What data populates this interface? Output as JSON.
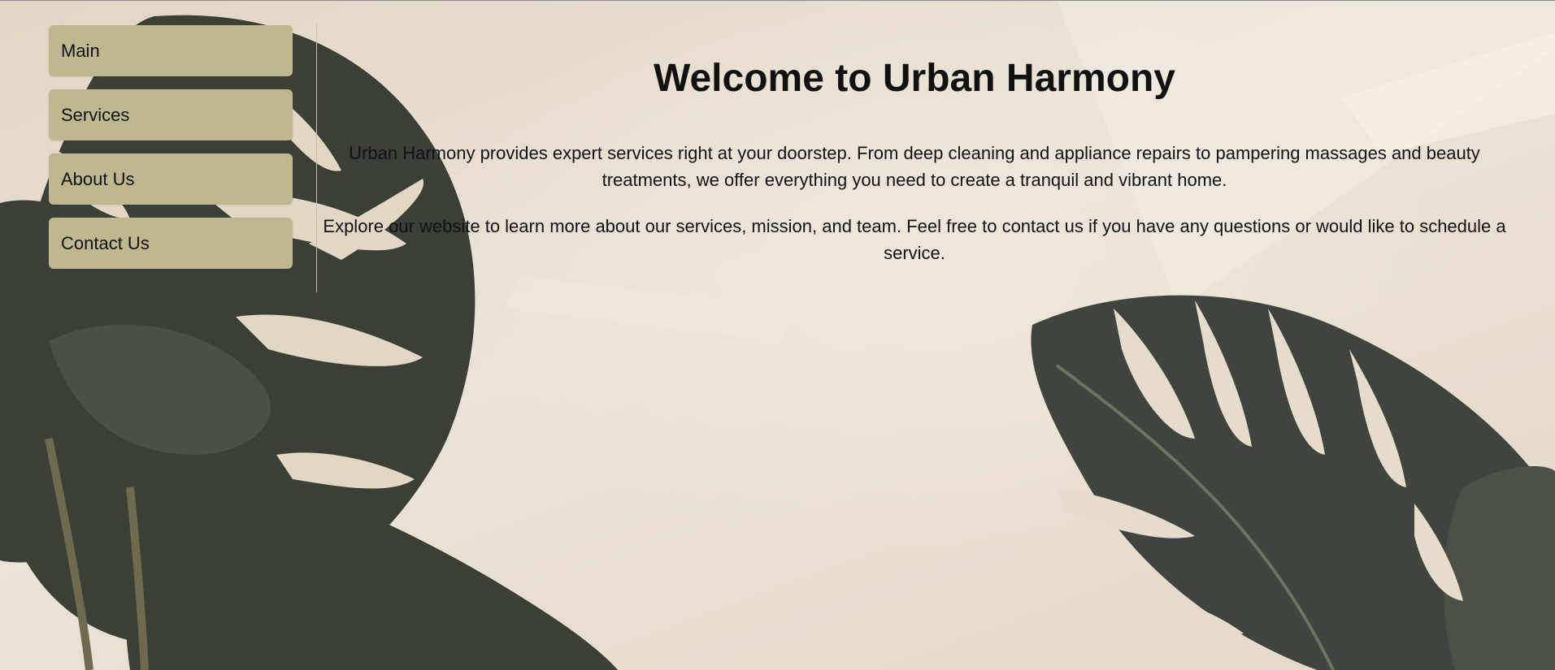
{
  "nav": {
    "items": [
      {
        "label": "Main"
      },
      {
        "label": "Services"
      },
      {
        "label": "About Us"
      },
      {
        "label": "Contact Us"
      }
    ]
  },
  "main": {
    "title": "Welcome to Urban Harmony",
    "paragraphs": [
      "Urban Harmony provides expert services right at your doorstep. From deep cleaning and appliance repairs to pampering massages and beauty treatments, we offer everything you need to create a tranquil and vibrant home.",
      "Explore our website to learn more about our services, mission, and team. Feel free to contact us if you have any questions or would like to schedule a service."
    ]
  },
  "colors": {
    "nav_button": "#bfb78f",
    "background": "#e6dccd",
    "leaf": "#3d4239"
  },
  "background_image": {
    "icon": "monstera-leaves-background"
  }
}
